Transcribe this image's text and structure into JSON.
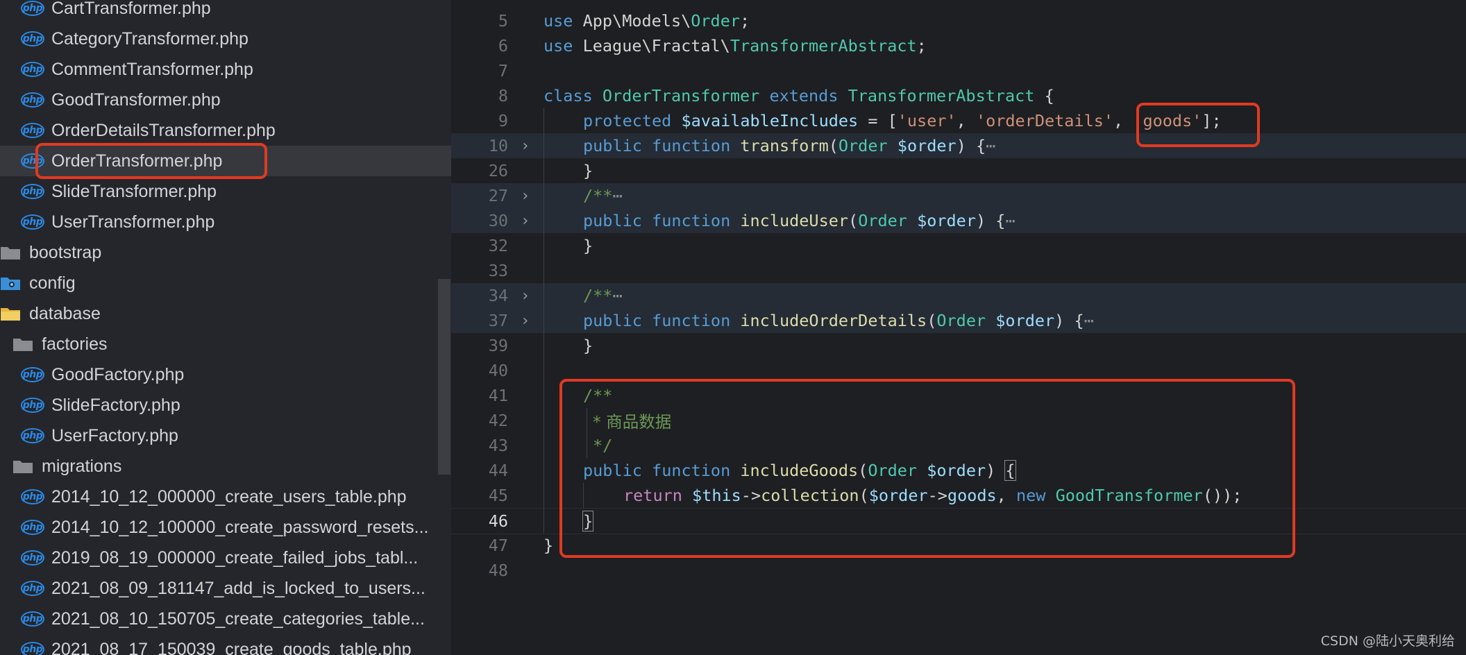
{
  "sidebar": {
    "items": [
      {
        "label": "CartTransformer.php",
        "kind": "file"
      },
      {
        "label": "CategoryTransformer.php",
        "kind": "file"
      },
      {
        "label": "CommentTransformer.php",
        "kind": "file"
      },
      {
        "label": "GoodTransformer.php",
        "kind": "file"
      },
      {
        "label": "OrderDetailsTransformer.php",
        "kind": "file"
      },
      {
        "label": "OrderTransformer.php",
        "kind": "file",
        "selected": true
      },
      {
        "label": "SlideTransformer.php",
        "kind": "file"
      },
      {
        "label": "UserTransformer.php",
        "kind": "file"
      },
      {
        "label": "bootstrap",
        "kind": "folder"
      },
      {
        "label": "config",
        "kind": "folder"
      },
      {
        "label": "database",
        "kind": "folder"
      },
      {
        "label": "factories",
        "kind": "subfolder"
      },
      {
        "label": "GoodFactory.php",
        "kind": "file"
      },
      {
        "label": "SlideFactory.php",
        "kind": "file"
      },
      {
        "label": "UserFactory.php",
        "kind": "file"
      },
      {
        "label": "migrations",
        "kind": "subfolder"
      },
      {
        "label": "2014_10_12_000000_create_users_table.php",
        "kind": "file"
      },
      {
        "label": "2014_10_12_100000_create_password_resets...",
        "kind": "file"
      },
      {
        "label": "2019_08_19_000000_create_failed_jobs_tabl...",
        "kind": "file"
      },
      {
        "label": "2021_08_09_181147_add_is_locked_to_users...",
        "kind": "file"
      },
      {
        "label": "2021_08_10_150705_create_categories_table...",
        "kind": "file"
      },
      {
        "label": "2021_08_17_150039_create_goods_table.php",
        "kind": "file"
      }
    ],
    "php_icon_text": "php"
  },
  "editor": {
    "line_numbers": [
      "5",
      "6",
      "7",
      "8",
      "9",
      "10",
      "26",
      "27",
      "30",
      "32",
      "33",
      "34",
      "37",
      "39",
      "40",
      "41",
      "42",
      "43",
      "44",
      "45",
      "46",
      "47",
      "48"
    ],
    "tokens": {
      "use": "use",
      "ns_app_models": "App\\Models\\",
      "order": "Order",
      "semi": ";",
      "ns_league": "League\\Fractal\\",
      "transformer_abstract": "TransformerAbstract",
      "class": "class",
      "order_transformer": "OrderTransformer",
      "extends": "extends",
      "brace_open": " {",
      "protected": "protected",
      "available_includes": "$availableIncludes",
      "eq_bracket": " = [",
      "user_str": "'user'",
      "comma": ", ",
      "order_details_str": "'orderDetails'",
      "goods_str": "'goods'",
      "close_arr": "];",
      "public": "public",
      "function": "function",
      "transform": "transform",
      "paren_open": "(",
      "order_var": "$order",
      "paren_close_brace": ") {",
      "ellipsis": "⋯",
      "brace_close": "}",
      "doc_open": "/**",
      "include_user": "includeUser",
      "include_order_details": "includeOrderDetails",
      "doc_cn": "* 商品数据",
      "doc_close": "*/",
      "include_goods": "includeGoods",
      "paren_close": ") ",
      "brace_match": "{",
      "return": "return",
      "this": "$this",
      "arrow": "->",
      "collection": "collection",
      "goods_prop": "goods",
      "new": "new",
      "good_transformer": "GoodTransformer",
      "call_end": "());",
      "fold_chevron": "›"
    }
  },
  "watermark": "CSDN @陆小天奥利给"
}
